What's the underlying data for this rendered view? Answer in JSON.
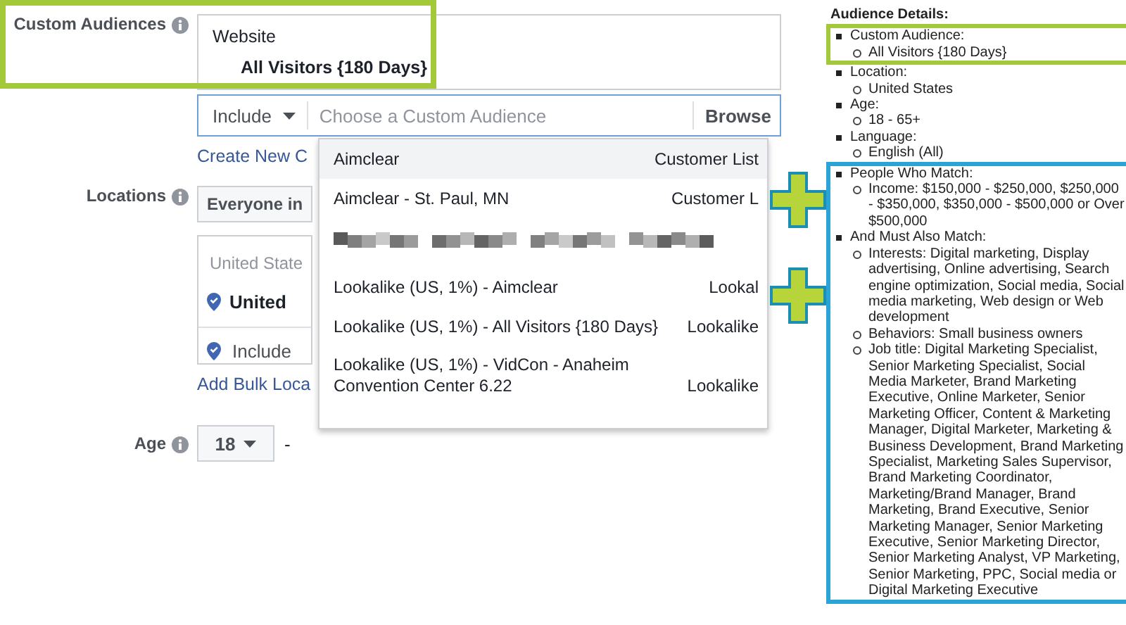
{
  "form": {
    "custom_audiences": {
      "label": "Custom Audiences",
      "group": "Website",
      "audience": "All Visitors {180 Days}",
      "include_select": "Include",
      "search": {
        "placeholder": "Choose a Custom Audience"
      },
      "browse": "Browse",
      "create_link": "Create New C",
      "color": "#a3c93a"
    },
    "locations": {
      "label": "Locations",
      "select": "Everyone in",
      "region": "United State",
      "location": "United",
      "include_select": "Include",
      "bulk_link": "Add Bulk Loca"
    },
    "age": {
      "label": "Age",
      "min": "18",
      "separator": "-"
    }
  },
  "dropdown": {
    "items": [
      {
        "kind": "text",
        "name": "Aimclear",
        "type": "Customer List",
        "selected": true
      },
      {
        "kind": "text",
        "name": "Aimclear - St. Paul, MN",
        "type": "Customer L",
        "selected": false
      },
      {
        "kind": "redacted",
        "selected": false
      },
      {
        "kind": "text",
        "name": "Lookalike (US, 1%) - Aimclear",
        "type": "Lookal",
        "selected": false
      },
      {
        "kind": "text",
        "name": "Lookalike (US, 1%) - All Visitors {180 Days}",
        "type": "Lookalike",
        "selected": false
      },
      {
        "kind": "text",
        "name": "Lookalike (US, 1%) - VidCon - Anaheim Convention Center 6.22",
        "type": "Lookalike",
        "selected": false
      }
    ]
  },
  "audience_details": {
    "title": "Audience Details:",
    "groups": [
      {
        "color": "#a3c93a",
        "sections": [
          {
            "heading": "Custom Audience:",
            "items": [
              "All Visitors {180 Days}"
            ]
          }
        ]
      },
      {
        "sections": [
          {
            "heading": "Location:",
            "items": [
              "United States"
            ]
          },
          {
            "heading": "Age:",
            "items": [
              "18 - 65+"
            ]
          },
          {
            "heading": "Language:",
            "items": [
              "English (All)"
            ]
          }
        ]
      },
      {
        "color": "#2aa3d6",
        "sections": [
          {
            "heading": "People Who Match:",
            "items": [
              "Income: $150,000 - $250,000, $250,000 - $350,000, $350,000 - $500,000 or Over $500,000"
            ]
          },
          {
            "heading": "And Must Also Match:",
            "items": [
              "Interests: Digital marketing, Display advertising, Online advertising, Search engine optimization, Social media, Social media marketing, Web design or Web development",
              "Behaviors: Small business owners",
              "Job title: Digital Marketing Specialist, Senior Marketing Specialist, Social Media Marketer, Brand Marketing Executive, Online Marketer, Senior Marketing Officer, Content & Marketing Manager, Digital Marketer, Marketing & Business Development, Brand Marketing Specialist, Marketing Sales Supervisor, Brand Marketing Coordinator, Marketing/Brand Manager, Brand Marketing, Brand Executive, Senior Marketing Manager, Senior Marketing Executive, Senior Marketing Director, Senior Marketing Analyst, VP Marketing, Senior Marketing, PPC, Social media or Digital Marketing Executive"
            ]
          }
        ]
      }
    ]
  }
}
